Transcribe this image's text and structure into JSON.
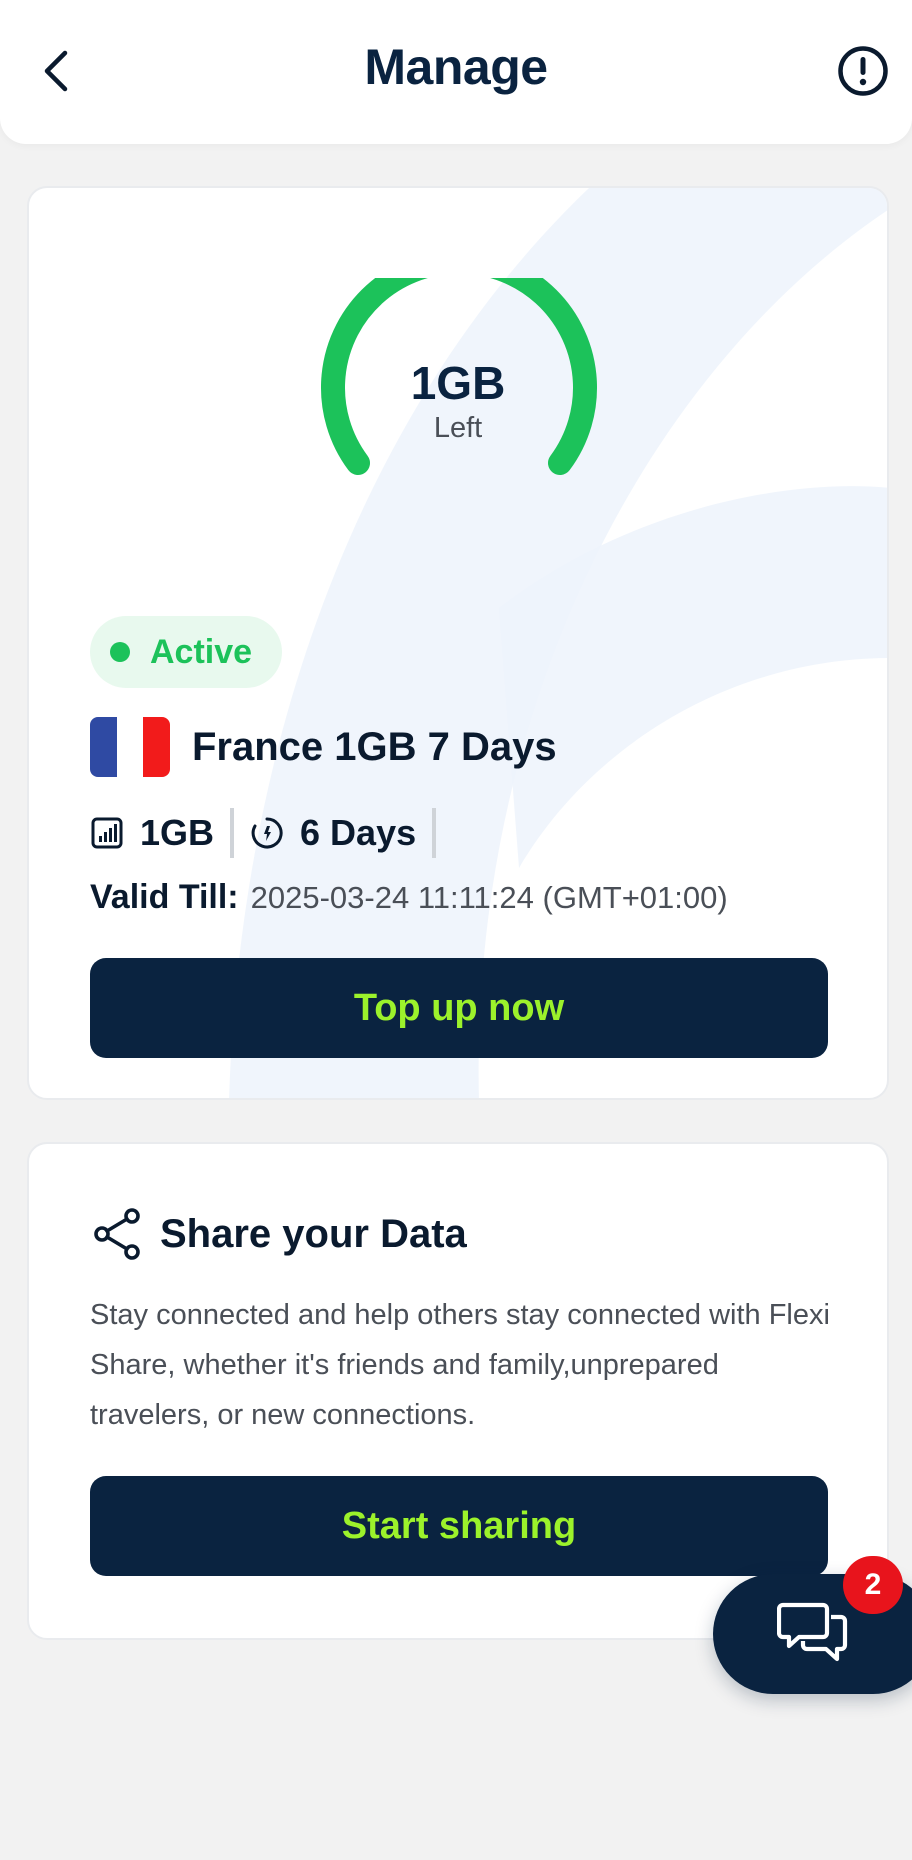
{
  "header": {
    "title": "Manage",
    "back_icon": "chevron-left-icon",
    "info_icon": "exclamation-circle-icon"
  },
  "plan_card": {
    "gauge": {
      "value": "1GB",
      "label": "Left",
      "remaining_fraction": 1.0
    },
    "status": "Active",
    "plan_name": "France 1GB 7 Days",
    "country_flag": "france-flag",
    "data_amount": "1GB",
    "duration": "6 Days",
    "valid_till_label": "Valid Till:",
    "valid_till_value": "2025-03-24 11:11:24 (GMT+01:00)",
    "topup_label": "Top up now"
  },
  "share_card": {
    "title": "Share your Data",
    "description": "Stay connected and help others stay connected with Flexi Share, whether it's friends and family,unprepared travelers, or new connections.",
    "button_label": "Start sharing"
  },
  "chat": {
    "badge_count": "2",
    "icon": "chat-bubbles-icon"
  },
  "colors": {
    "navy": "#0a2340",
    "accent_green": "#1cc25a",
    "button_text_lime": "#9cf22b",
    "badge_red": "#e8141c",
    "background": "#f2f2f2"
  }
}
